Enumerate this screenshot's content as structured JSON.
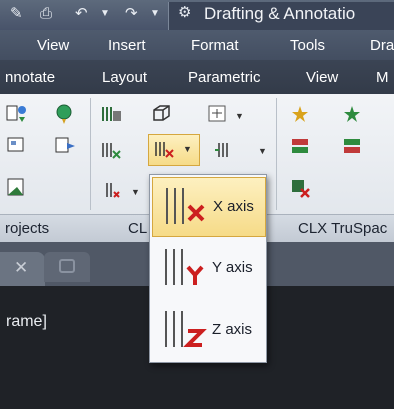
{
  "title_bar": {
    "workspace_text": "Drafting & Annotatio"
  },
  "menu_bar": {
    "items": [
      "View",
      "Insert",
      "Format",
      "Tools",
      "Dra"
    ]
  },
  "ribbon_tabs": {
    "items": [
      "nnotate",
      "Layout",
      "Parametric",
      "View",
      "M"
    ]
  },
  "panels": {
    "left": "rojects",
    "middle": "CL",
    "right": "CLX TruSpac"
  },
  "dropdown": {
    "items": [
      {
        "label": "X axis",
        "axis": "X",
        "selected": true
      },
      {
        "label": "Y axis",
        "axis": "Y",
        "selected": false
      },
      {
        "label": "Z axis",
        "axis": "Z",
        "selected": false
      }
    ]
  },
  "command_line": {
    "text": "rame]"
  },
  "colors": {
    "axis_marker": "#cc1f1f",
    "highlight": "#f6db88"
  }
}
